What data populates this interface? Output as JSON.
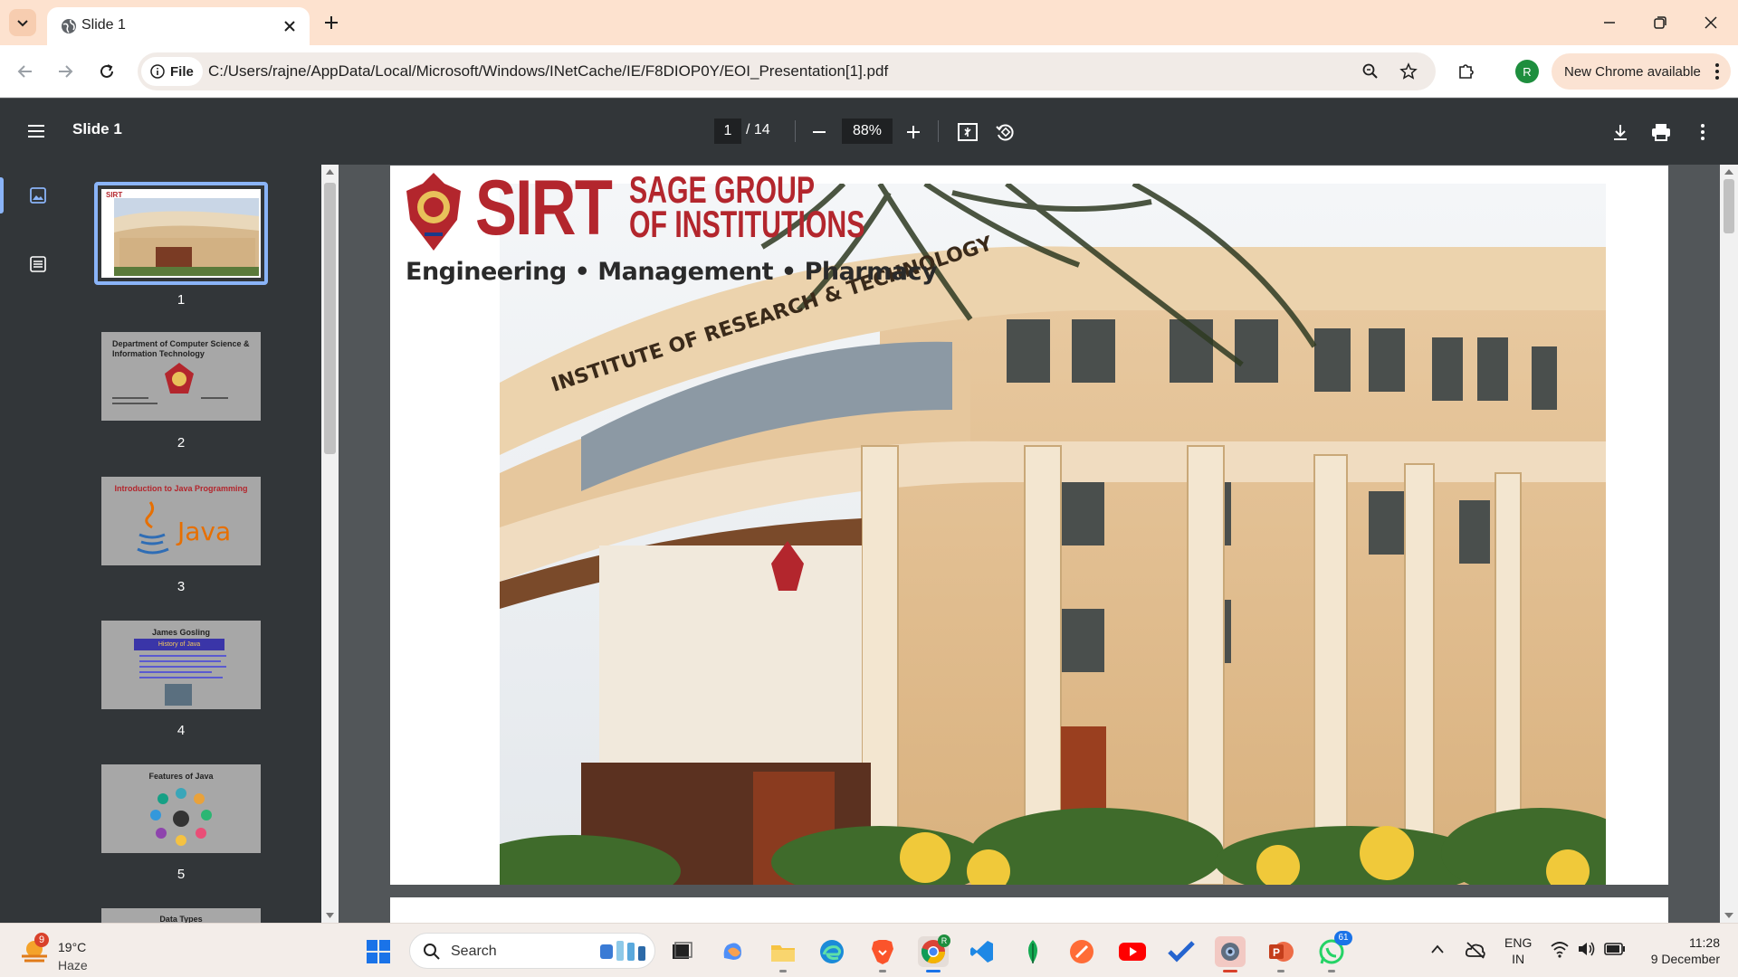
{
  "browser": {
    "tab": {
      "title": "Slide 1"
    },
    "omnibox": {
      "chip_label": "File",
      "url": "C:/Users/rajne/AppData/Local/Microsoft/Windows/INetCache/IE/F8DIOP0Y/EOI_Presentation[1].pdf"
    },
    "profile_initial": "R",
    "update_label": "New Chrome available"
  },
  "pdf": {
    "title": "Slide 1",
    "current_page": "1",
    "page_total": "/ 14",
    "zoom": "88%"
  },
  "thumbnails": [
    {
      "number": "1",
      "text": ""
    },
    {
      "number": "2",
      "text": "Department of Computer Science & Information Technology"
    },
    {
      "number": "3",
      "text": "Introduction to Java Programming",
      "logo_text": "Java"
    },
    {
      "number": "4",
      "text": "James Gosling",
      "subtext": "History of Java"
    },
    {
      "number": "5",
      "text": "Features of Java"
    },
    {
      "number": "",
      "text": "Data Types"
    }
  ],
  "slide": {
    "logo_main": "SIRT",
    "logo_group_line1": "SAGE GROUP",
    "logo_group_line2": "OF INSTITUTIONS",
    "subtitle": "Engineering • Management • Pharmacy",
    "building_sign": "INSTITUTE OF RESEARCH & TECHNOLOGY"
  },
  "taskbar": {
    "weather_temp": "19°C",
    "weather_cond": "Haze",
    "weather_badge": "9",
    "search_label": "Search",
    "whatsapp_badge": "61",
    "lang_line1": "ENG",
    "lang_line2": "IN",
    "time": "11:28",
    "date": "9 December"
  }
}
